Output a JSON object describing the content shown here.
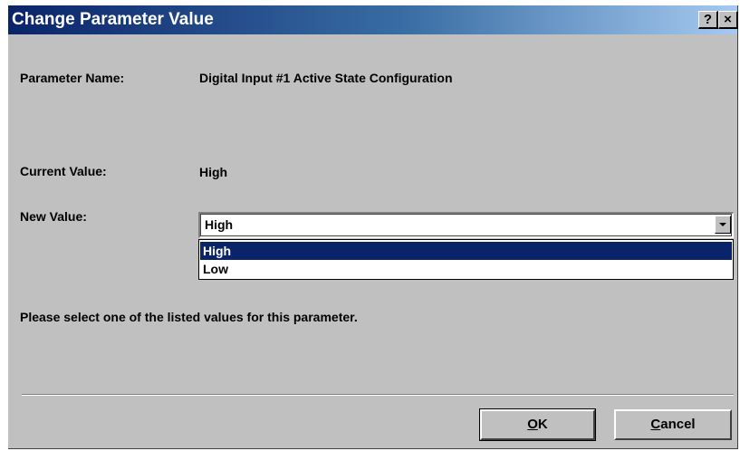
{
  "window": {
    "title": "Change Parameter Value",
    "help_button": "?",
    "close_button": "×"
  },
  "parameter": {
    "name_label": "Parameter Name:",
    "name_value": "Digital Input #1 Active State Configuration",
    "current_label": "Current Value:",
    "current_value": "High",
    "new_label": "New Value:",
    "new_value": "High",
    "options": [
      "High",
      "Low"
    ],
    "selected_option": "High"
  },
  "instructions": "Please select one of the listed values for this parameter.",
  "buttons": {
    "ok_mnemonic": "O",
    "ok_rest": "K",
    "cancel_mnemonic": "C",
    "cancel_rest": "ancel"
  },
  "colors": {
    "titlebar_start": "#0a246a",
    "titlebar_end": "#a6caf0",
    "dialog_face": "#c0c0c0",
    "selection": "#0a246a"
  }
}
